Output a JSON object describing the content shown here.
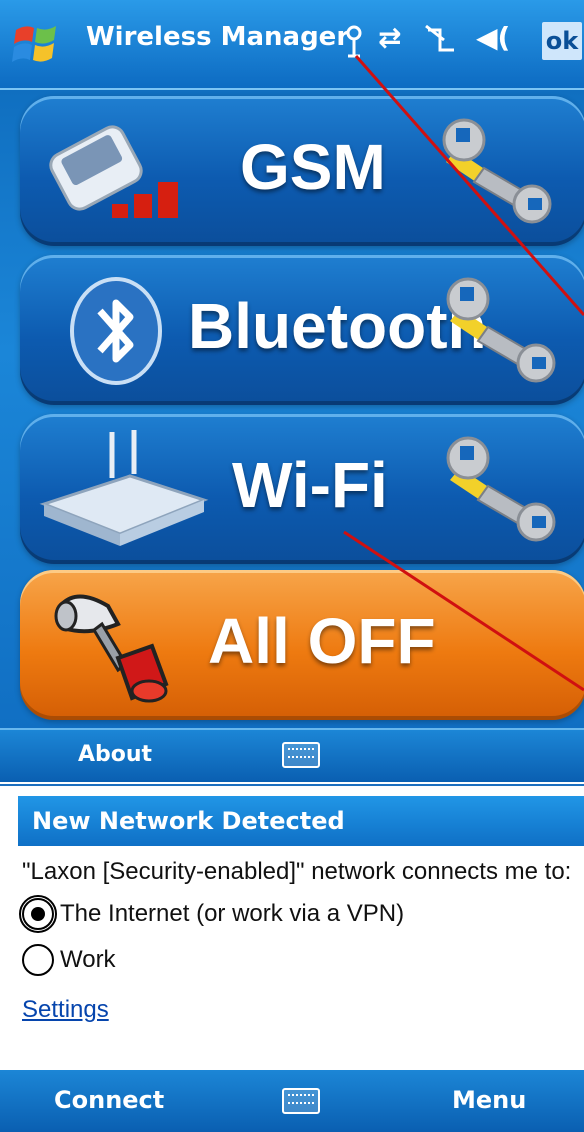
{
  "top_screen": {
    "title": "Wireless Manager",
    "status_icons": [
      "antenna-icon",
      "sync-arrows-icon",
      "signal-off-icon",
      "speaker-icon"
    ],
    "ok_label": "ok",
    "buttons": [
      {
        "label": "GSM",
        "icon": "pda-phone-icon"
      },
      {
        "label": "Bluetooth",
        "icon": "bluetooth-icon"
      },
      {
        "label": "Wi-Fi",
        "icon": "router-icon"
      },
      {
        "label": "All OFF",
        "icon": "hammer-icon"
      }
    ],
    "softkeys": {
      "left": "About"
    }
  },
  "dialog": {
    "title": "New Network Detected",
    "message": "\"Laxon [Security-enabled]\" network connects me to:",
    "options": [
      {
        "label": "The Internet (or work via a VPN)",
        "selected": true
      },
      {
        "label": "Work",
        "selected": false
      }
    ],
    "settings_link": "Settings",
    "softkeys": {
      "left": "Connect",
      "right": "Menu"
    }
  },
  "colors": {
    "panel_blue": "#0d5bb0",
    "all_off_orange": "#ee7a10",
    "annotation_red": "#d01010"
  }
}
